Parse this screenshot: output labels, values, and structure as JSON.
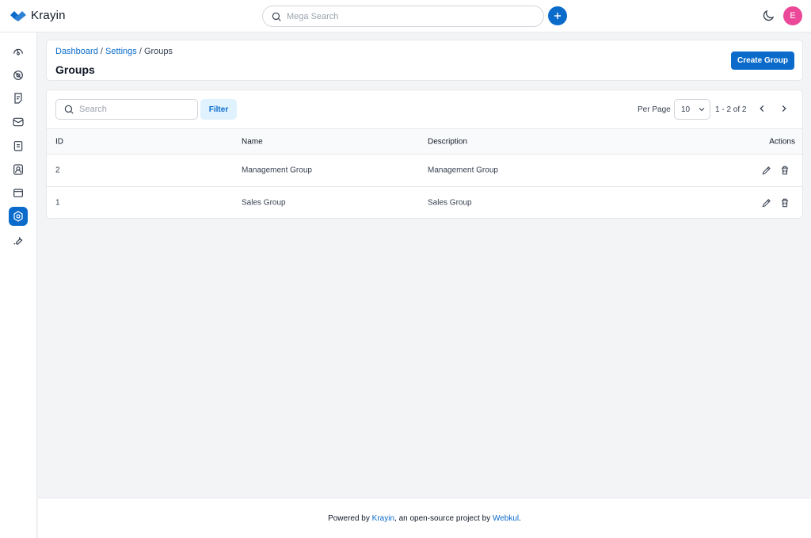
{
  "app": {
    "name": "Krayin"
  },
  "topbar": {
    "search_placeholder": "Mega Search",
    "avatar_initial": "E"
  },
  "sidebar": {
    "items": [
      {
        "icon": "dashboard-icon",
        "active": false
      },
      {
        "icon": "leads-icon",
        "active": false
      },
      {
        "icon": "quotes-icon",
        "active": false
      },
      {
        "icon": "mail-icon",
        "active": false
      },
      {
        "icon": "activities-icon",
        "active": false
      },
      {
        "icon": "contacts-icon",
        "active": false
      },
      {
        "icon": "products-icon",
        "active": false
      },
      {
        "icon": "settings-icon",
        "active": true
      },
      {
        "icon": "configuration-icon",
        "active": false
      }
    ]
  },
  "breadcrumb": {
    "dashboard": "Dashboard",
    "settings": "Settings",
    "current": "Groups",
    "separator": "/"
  },
  "page": {
    "title": "Groups",
    "create_button": "Create Group"
  },
  "toolbar": {
    "search_placeholder": "Search",
    "filter_label": "Filter",
    "per_page_label": "Per Page",
    "per_page_value": "10",
    "page_info": "1 - 2 of 2"
  },
  "table": {
    "columns": {
      "id": "ID",
      "name": "Name",
      "description": "Description",
      "actions": "Actions"
    },
    "rows": [
      {
        "id": "2",
        "name": "Management Group",
        "description": "Management Group"
      },
      {
        "id": "1",
        "name": "Sales Group",
        "description": "Sales Group"
      }
    ]
  },
  "footer": {
    "prefix": "Powered by",
    "krayin_link": "Krayin",
    "middle": ", an open-source project by",
    "webkul_link": "Webkul",
    "suffix": "."
  },
  "colors": {
    "accent": "#0b6bcb",
    "avatar": "#ec4899",
    "filter_bg": "#e0f2fe"
  }
}
